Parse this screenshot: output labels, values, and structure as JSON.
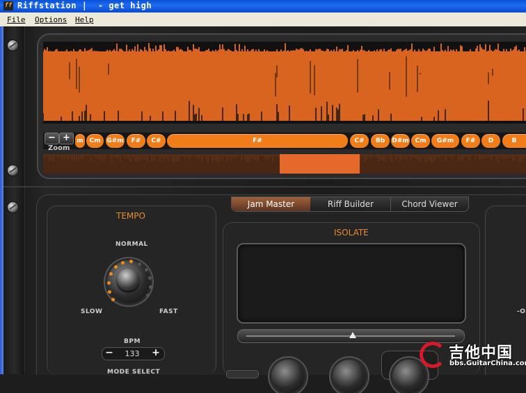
{
  "window": {
    "title": "Riffstation |  - get high",
    "icon_glyph": "ff"
  },
  "menu": {
    "items": [
      "File",
      "Options",
      "Help"
    ]
  },
  "waveform": {
    "chords": [
      "m",
      "Cm",
      "G#m",
      "F#",
      "C#",
      "F#",
      "C#",
      "Bb",
      "D#m",
      "Cm",
      "G#m",
      "F#",
      "D",
      "B"
    ],
    "zoom_label": "Zoom",
    "zoom_out": "−",
    "zoom_in": "+",
    "accent": "#f07d19"
  },
  "tabs": [
    {
      "label": "Jam Master",
      "active": true
    },
    {
      "label": "Riff Builder",
      "active": false
    },
    {
      "label": "Chord Viewer",
      "active": false
    }
  ],
  "tempo": {
    "title": "TEMPO",
    "normal": "NORMAL",
    "slow": "SLOW",
    "fast": "FAST",
    "bpm_label": "BPM",
    "bpm_value": "133",
    "minus": "−",
    "plus": "+",
    "mode_select": "MODE SELECT"
  },
  "isolate": {
    "title": "ISOLATE"
  },
  "right_partial": {
    "label": "-O"
  },
  "watermark": {
    "cn": "吉他中国",
    "url": "bbs.GuitarChina.com"
  }
}
